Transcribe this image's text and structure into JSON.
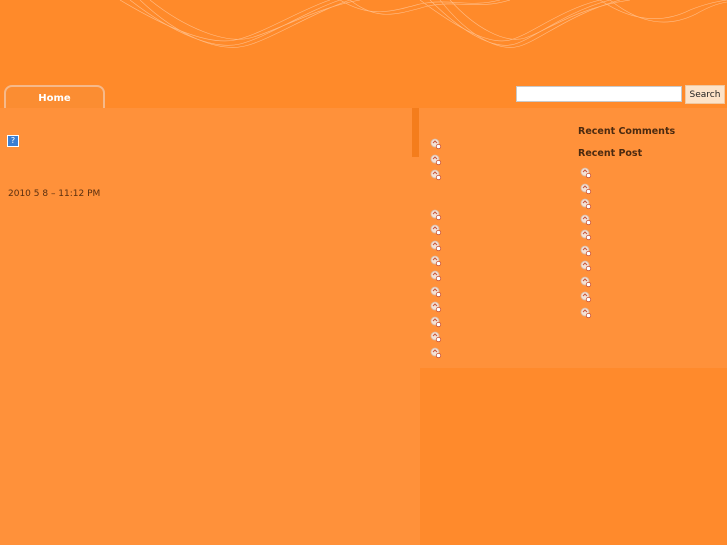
{
  "nav": {
    "home_label": "Home"
  },
  "search": {
    "placeholder": "",
    "value": "",
    "button_label": "Search"
  },
  "post": {
    "broken_image_glyph": "?",
    "date": "2010 5 8  – 11:12 PM"
  },
  "sidebar": {
    "recent_comments_heading": "Recent Comments",
    "recent_post_heading": "Recent Post",
    "left_list_group1_count": 3,
    "left_list_group2_count": 10,
    "right_list_count": 10
  },
  "colors": {
    "background": "#fe8a2c",
    "content": "#ff913a",
    "tab_border": "#f6b98a",
    "bullet": "#f5e6dc"
  },
  "icons": {
    "bullet": "bullet-icon",
    "broken_image": "broken-image-icon"
  }
}
